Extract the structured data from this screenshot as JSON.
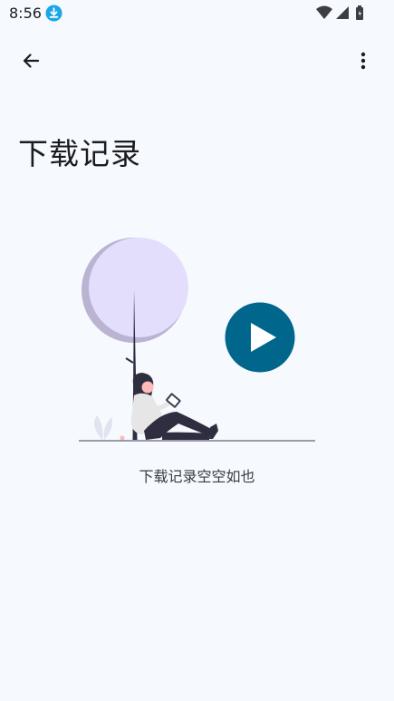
{
  "status_bar": {
    "time": "8:56",
    "icons": [
      "download-notification-icon",
      "wifi-icon",
      "signal-icon",
      "battery-icon"
    ]
  },
  "app_bar": {
    "back_icon": "arrow-back-icon",
    "menu_icon": "more-vert-icon"
  },
  "page": {
    "title": "下载记录"
  },
  "empty_state": {
    "illustration": "person-reading-under-tree-with-play-button",
    "message": "下载记录空空如也"
  },
  "colors": {
    "background": "#f6f9fe",
    "accent_download": "#1aa6e8",
    "play_button": "#00668b",
    "tree_light": "#e4defd",
    "tree_shadow": "#bab3d2"
  }
}
